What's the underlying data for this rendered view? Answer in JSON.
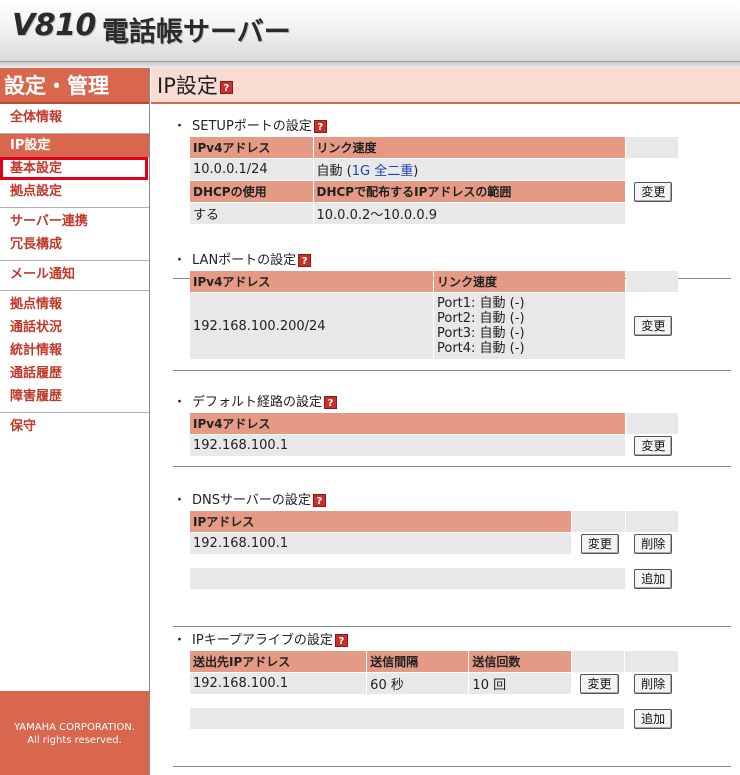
{
  "header": {
    "model": "V810",
    "product": "電話帳サーバー"
  },
  "sidebar": {
    "title": "設定・管理",
    "groups": [
      {
        "items": [
          {
            "label": "全体情報"
          }
        ]
      },
      {
        "items": [
          {
            "label": "IP設定"
          },
          {
            "label": "基本設定"
          },
          {
            "label": "拠点設定"
          }
        ]
      },
      {
        "items": [
          {
            "label": "サーバー連携"
          },
          {
            "label": "冗長構成"
          }
        ]
      },
      {
        "items": [
          {
            "label": "メール通知"
          }
        ]
      },
      {
        "items": [
          {
            "label": "拠点情報"
          },
          {
            "label": "通話状況"
          },
          {
            "label": "統計情報"
          },
          {
            "label": "通話履歴"
          },
          {
            "label": "障害履歴"
          }
        ]
      },
      {
        "items": [
          {
            "label": "保守"
          }
        ]
      }
    ],
    "footer_line1": "YAMAHA CORPORATION.",
    "footer_line2": "All rights reserved."
  },
  "main": {
    "title": "IP設定",
    "help_glyph": "?",
    "bullet": "・",
    "setup": {
      "title": "SETUPポートの設定",
      "col_ipv4": "IPv4アドレス",
      "col_link": "リンク速度",
      "ipv4": "10.0.0.1/24",
      "link_prefix": "自動 (",
      "link_speed": "1G 全二重",
      "link_suffix": ")",
      "col_dhcp": "DHCPの使用",
      "col_dhcp_range": "DHCPで配布するIPアドレスの範囲",
      "dhcp": "する",
      "dhcp_range": "10.0.0.2～10.0.0.9",
      "change_label": "変更"
    },
    "lan": {
      "title": "LANポートの設定",
      "col_ipv4": "IPv4アドレス",
      "col_link": "リンク速度",
      "ipv4": "192.168.100.200/24",
      "ports": [
        "Port1: 自動 (-)",
        "Port2: 自動 (-)",
        "Port3: 自動 (-)",
        "Port4: 自動 (-)"
      ],
      "change_label": "変更"
    },
    "default_route": {
      "title": "デフォルト経路の設定",
      "col_ipv4": "IPv4アドレス",
      "ipv4": "192.168.100.1",
      "change_label": "変更"
    },
    "dns": {
      "title": "DNSサーバーの設定",
      "col_ip": "IPアドレス",
      "ip": "192.168.100.1",
      "change_label": "変更",
      "delete_label": "削除",
      "add_label": "追加"
    },
    "keepalive": {
      "title": "IPキープアライブの設定",
      "col_dest": "送出先IPアドレス",
      "col_interval": "送信間隔",
      "col_count": "送信回数",
      "dest": "192.168.100.1",
      "interval": "60 秒",
      "count": "10 回",
      "change_label": "変更",
      "delete_label": "削除",
      "add_label": "追加"
    }
  }
}
